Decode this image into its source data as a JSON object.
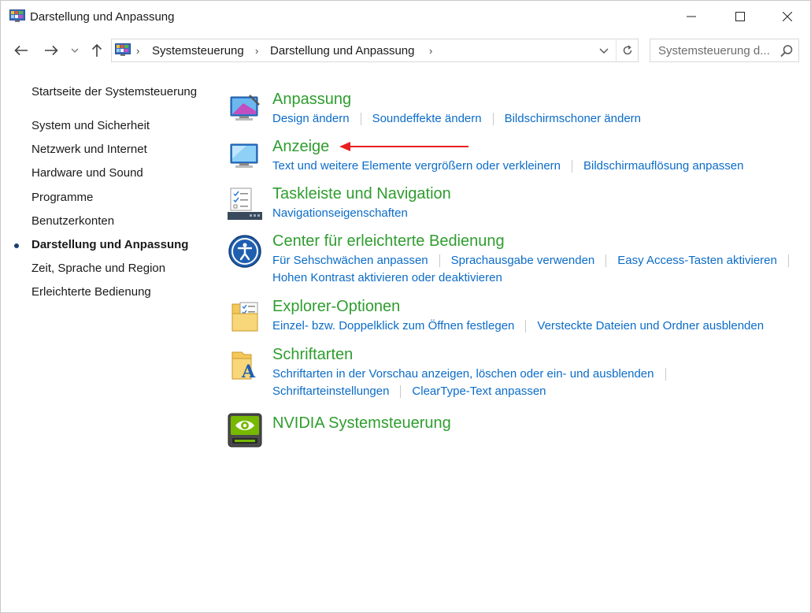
{
  "window": {
    "title": "Darstellung und Anpassung"
  },
  "address": {
    "crumbs": [
      "Systemsteuerung",
      "Darstellung und Anpassung"
    ],
    "search_placeholder": "Systemsteuerung d..."
  },
  "leftnav": {
    "home": "Startseite der Systemsteuerung",
    "items": [
      "System und Sicherheit",
      "Netzwerk und Internet",
      "Hardware und Sound",
      "Programme",
      "Benutzerkonten",
      "Darstellung und Anpassung",
      "Zeit, Sprache und Region",
      "Erleichterte Bedienung"
    ],
    "active_index": 5
  },
  "categories": [
    {
      "title": "Anpassung",
      "icon": "personalization-icon",
      "rows": [
        [
          "Design ändern",
          "Soundeffekte ändern",
          "Bildschirmschoner ändern"
        ]
      ]
    },
    {
      "title": "Anzeige",
      "icon": "display-icon",
      "rows": [
        [
          "Text und weitere Elemente vergrößern oder verkleinern",
          "Bildschirmauflösung anpassen"
        ]
      ]
    },
    {
      "title": "Taskleiste und Navigation",
      "icon": "taskbar-icon",
      "rows": [
        [
          "Navigationseigenschaften"
        ]
      ]
    },
    {
      "title": "Center für erleichterte Bedienung",
      "icon": "ease-of-access-icon",
      "rows": [
        [
          "Für Sehschwächen anpassen",
          "Sprachausgabe verwenden",
          "Easy Access-Tasten aktivieren"
        ],
        [
          "Hohen Kontrast aktivieren oder deaktivieren"
        ]
      ]
    },
    {
      "title": "Explorer-Optionen",
      "icon": "folder-options-icon",
      "rows": [
        [
          "Einzel- bzw. Doppelklick zum Öffnen festlegen",
          "Versteckte Dateien und Ordner ausblenden"
        ]
      ]
    },
    {
      "title": "Schriftarten",
      "icon": "fonts-icon",
      "rows": [
        [
          "Schriftarten in der Vorschau anzeigen, löschen oder ein- und ausblenden"
        ],
        [
          "Schriftarteinstellungen",
          "ClearType-Text anpassen"
        ]
      ]
    },
    {
      "title": "NVIDIA Systemsteuerung",
      "icon": "nvidia-icon",
      "rows": []
    }
  ],
  "colors": {
    "title_green": "#2f9d2f",
    "link_blue": "#0b6cc8",
    "annotation_arrow": "#e8201f"
  }
}
